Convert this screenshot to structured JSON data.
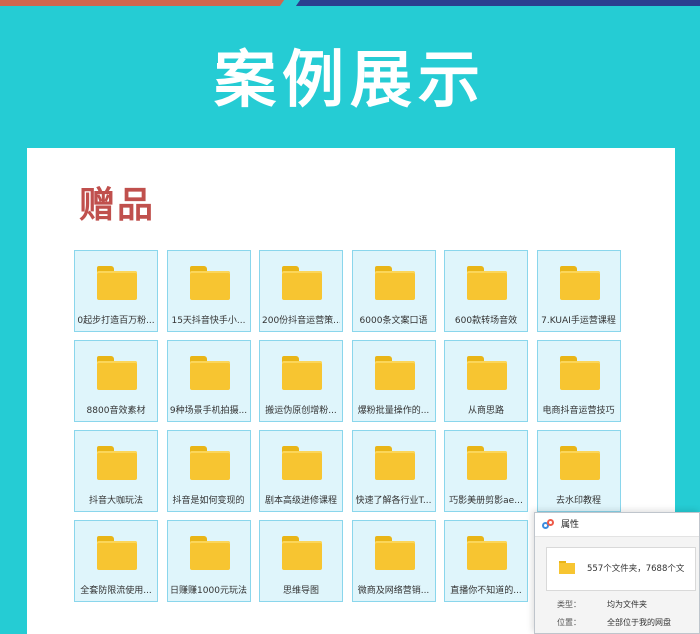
{
  "heading": "案例展示",
  "section_title": "赠品",
  "folders": [
    "0起步打造百万粉...",
    "15天抖音快手小...",
    "200份抖音运营策...",
    "6000条文案口语",
    "600款转场音效",
    "7.KUAI手运营课程",
    "8800音效素材",
    "9种场景手机拍摄...",
    "搬运伪原创增粉...",
    "爆粉批量操作的...",
    "从商思路",
    "电商抖音运营技巧",
    "抖音大咖玩法",
    "抖音是如何变现的",
    "剧本高级进修课程",
    "快速了解各行业T...",
    "巧影美册剪影ae...",
    "去水印教程",
    "全套防限流使用...",
    "日赚赚1000元玩法",
    "思维导图",
    "微商及网络营销...",
    "直播你不知道的..."
  ],
  "properties_dialog": {
    "title": "属性",
    "summary": "557个文件夹，7688个文",
    "rows": [
      {
        "label": "类型：",
        "value": "均为文件夹"
      },
      {
        "label": "位置：",
        "value": "全部位于我的网盘"
      }
    ]
  },
  "colors": {
    "background": "#25ccd4",
    "section_title": "#c0504d",
    "tile_bg": "#dff5fb",
    "tile_border": "#8ad6ec",
    "folder": "#f7c531"
  }
}
